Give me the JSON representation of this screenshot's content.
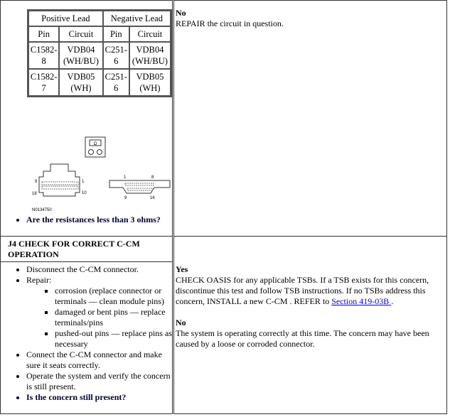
{
  "table": {
    "headers": [
      "Positive Lead",
      "Negative Lead"
    ],
    "subheaders": [
      "Pin",
      "Circuit",
      "Pin",
      "Circuit"
    ],
    "rows": [
      [
        "C1582-8",
        "VDB04 (WH/BU)",
        "C251-6",
        "VDB04 (WH/BU)"
      ],
      [
        "C1582-7",
        "VDB05 (WH)",
        "C251-6",
        "VDB05 (WH)"
      ]
    ]
  },
  "figure": {
    "id": "N0134750",
    "meter_symbol": "Ω",
    "pins": {
      "a_top": "9",
      "a_right_top": "1",
      "a_bottom": "18",
      "a_right_bottom": "10",
      "b_tl": "1",
      "b_tr": "8",
      "b_bl": "9",
      "b_br": "16"
    }
  },
  "j3": {
    "question": "Are the resistances less than 3 ohms?",
    "no_label": "No",
    "no_text": "REPAIR the circuit in question."
  },
  "j4": {
    "title": "J4 CHECK FOR CORRECT C-CM OPERATION",
    "steps": [
      "Disconnect the C-CM connector.",
      "Repair:"
    ],
    "repair": [
      "corrosion (replace connector or terminals — clean module pins)",
      "damaged or bent pins — replace terminals/pins",
      "pushed-out pins — replace pins as necessary"
    ],
    "steps2": [
      "Connect the C-CM connector and make sure it seats correctly.",
      "Operate the system and verify the concern is still present."
    ],
    "question": "Is the concern still present?",
    "yes_label": "Yes",
    "yes_text": "CHECK OASIS for any applicable TSBs. If a TSB exists for this concern, discontinue this test and follow TSB instructions. If no TSBs address this concern, INSTALL a new C-CM . REFER to ",
    "yes_link": "Section 419-03B ",
    "yes_end": ".",
    "no_label": "No",
    "no_text": "The system is operating correctly at this time. The concern may have been caused by a loose or corroded connector."
  }
}
